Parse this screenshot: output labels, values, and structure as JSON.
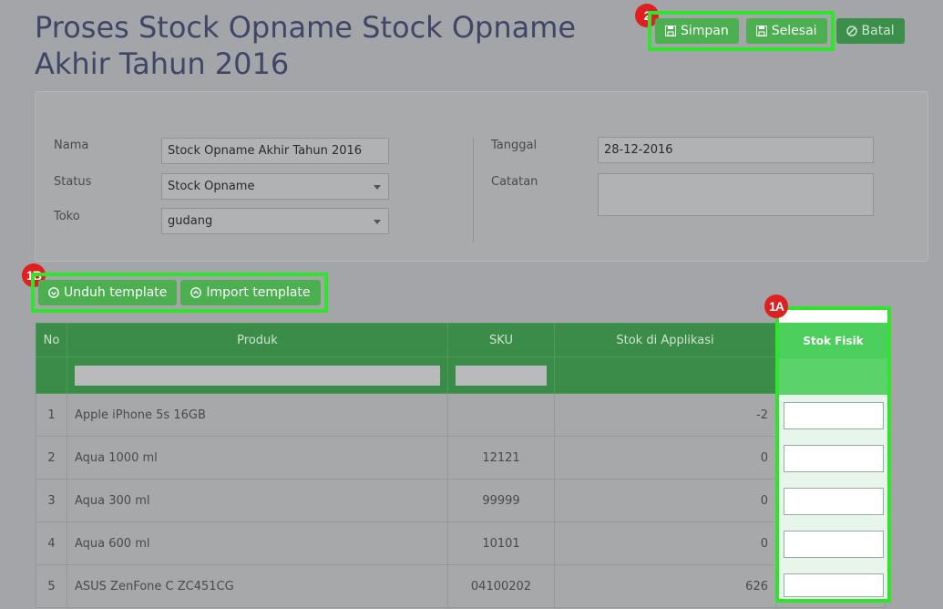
{
  "header": {
    "title": "Proses Stock Opname Stock Opname Akhir Tahun 2016"
  },
  "actions": {
    "simpan": "Simpan",
    "selesai": "Selesai",
    "batal": "Batal"
  },
  "badges": {
    "actions": "2",
    "template": "1B",
    "stok_fisik": "1A"
  },
  "form": {
    "nama_label": "Nama",
    "nama_value": "Stock Opname Akhir Tahun 2016",
    "status_label": "Status",
    "status_value": "Stock Opname",
    "toko_label": "Toko",
    "toko_value": "gudang",
    "tanggal_label": "Tanggal",
    "tanggal_value": "28-12-2016",
    "catatan_label": "Catatan",
    "catatan_value": ""
  },
  "template_buttons": {
    "unduh": "Unduh template",
    "import": "Import template"
  },
  "table": {
    "headers": {
      "no": "No",
      "produk": "Produk",
      "sku": "SKU",
      "stok_app": "Stok di Applikasi",
      "stok_fisik": "Stok Fisik"
    },
    "rows": [
      {
        "no": "1",
        "produk": "Apple iPhone 5s 16GB",
        "sku": "",
        "stok_app": "-2"
      },
      {
        "no": "2",
        "produk": "Aqua 1000 ml",
        "sku": "12121",
        "stok_app": "0"
      },
      {
        "no": "3",
        "produk": "Aqua 300 ml",
        "sku": "99999",
        "stok_app": "0"
      },
      {
        "no": "4",
        "produk": "Aqua 600 ml",
        "sku": "10101",
        "stok_app": "0"
      },
      {
        "no": "5",
        "produk": "ASUS ZenFone C ZC451CG",
        "sku": "04100202",
        "stok_app": "626"
      }
    ]
  },
  "colors": {
    "highlight": "#2ee52b",
    "badge": "#e02020",
    "primary_green": "#4caf50"
  }
}
